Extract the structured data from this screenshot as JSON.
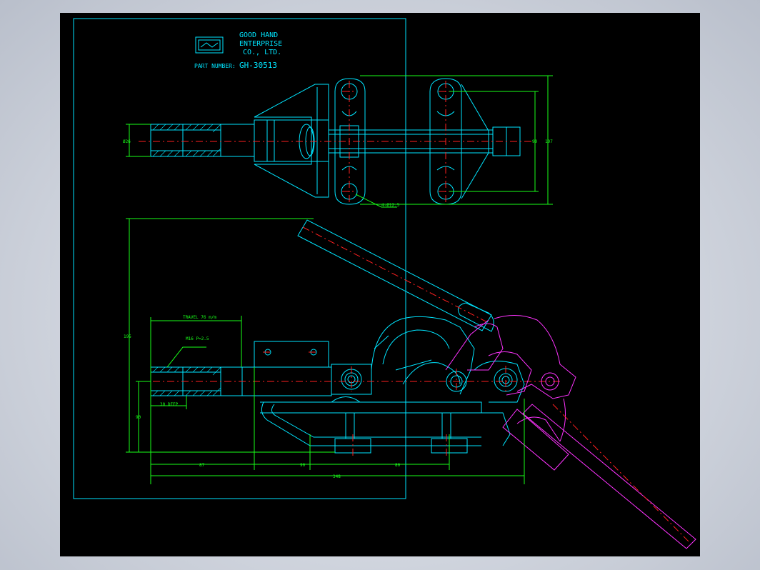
{
  "titleblock": {
    "company_line1": "GOOD HAND",
    "company_line2": "ENTERPRISE",
    "company_line3": "CO., LTD.",
    "part_number_label": "PART NUMBER:",
    "part_number_value": "GH-30513"
  },
  "dimensions": {
    "dia_top": "Ø26",
    "hole_callout": "4-Ø12.5",
    "height_inner": "90",
    "height_outer": "107",
    "travel": "TRAVEL 76 m/m",
    "thread": "M16 P=2.5",
    "total_height": "195",
    "base_height": "90",
    "deep": "30 DEEP",
    "len_a": "87",
    "len_b": "90",
    "len_c": "80",
    "total_len": "348"
  },
  "colors": {
    "outline": "#00e5ff",
    "dimension": "#19ff19",
    "centerline": "#ff2020",
    "alternate_position": "#ff33ff",
    "background": "#000000"
  }
}
